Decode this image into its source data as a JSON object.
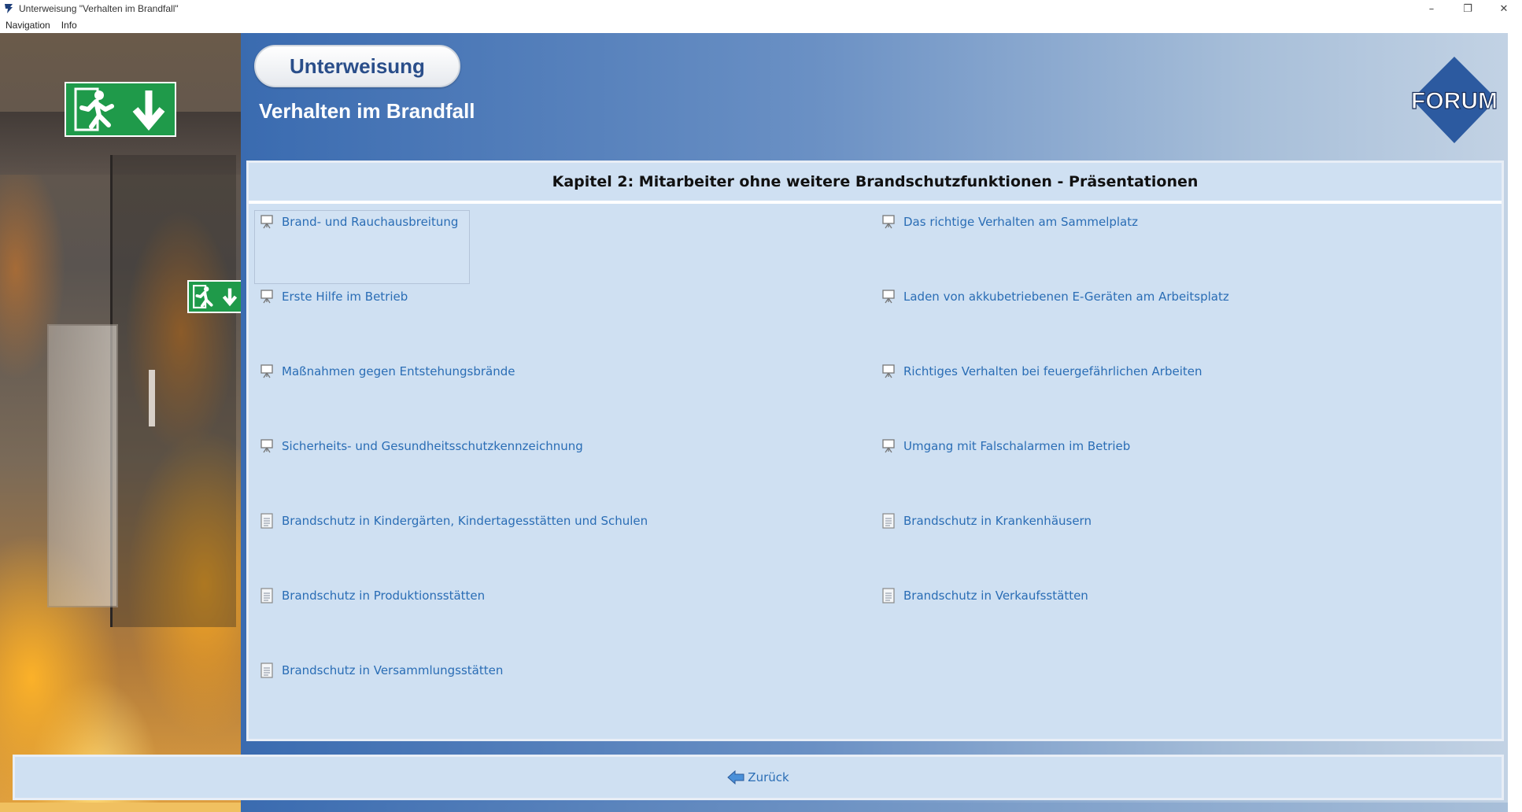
{
  "window": {
    "title": "Unterweisung \"Verhalten im Brandfall\"",
    "minimize": "–",
    "maximize": "❐",
    "close": "✕"
  },
  "menu": [
    {
      "label": "Navigation"
    },
    {
      "label": "Info"
    }
  ],
  "header": {
    "pill_label": "Unterweisung",
    "subtitle": "Verhalten im Brandfall",
    "logo_text": "FORUM"
  },
  "content": {
    "title": "Kapitel 2: Mitarbeiter ohne weitere Brandschutzfunktionen - Präsentationen",
    "left_items": [
      {
        "label": "Brand- und Rauchausbreitung",
        "icon": "presentation-icon"
      },
      {
        "label": "Erste Hilfe im Betrieb",
        "icon": "presentation-icon"
      },
      {
        "label": "Maßnahmen gegen Entstehungsbrände",
        "icon": "presentation-icon"
      },
      {
        "label": "Sicherheits- und Gesundheitsschutzkennzeichnung",
        "icon": "presentation-icon"
      },
      {
        "label": "Brandschutz in Kindergärten, Kindertagesstätten und Schulen",
        "icon": "document-icon"
      },
      {
        "label": "Brandschutz in Produktionsstätten",
        "icon": "document-icon"
      },
      {
        "label": "Brandschutz in Versammlungsstätten",
        "icon": "document-icon"
      }
    ],
    "right_items": [
      {
        "label": "Das richtige Verhalten am Sammelplatz",
        "icon": "presentation-icon"
      },
      {
        "label": "Laden von akkubetriebenen E-Geräten am Arbeitsplatz",
        "icon": "presentation-icon"
      },
      {
        "label": "Richtiges Verhalten bei feuergefährlichen Arbeiten",
        "icon": "presentation-icon"
      },
      {
        "label": "Umgang mit Falschalarmen im Betrieb",
        "icon": "presentation-icon"
      },
      {
        "label": "Brandschutz in Krankenhäusern",
        "icon": "document-icon"
      },
      {
        "label": "Brandschutz in Verkaufsstätten",
        "icon": "document-icon"
      }
    ]
  },
  "footer": {
    "back_label": "Zurück"
  },
  "colors": {
    "link": "#2a6db5",
    "panel": "#cfe0f2",
    "header_blue": "#3a6bb0",
    "exit_green": "#1f9a4a"
  }
}
